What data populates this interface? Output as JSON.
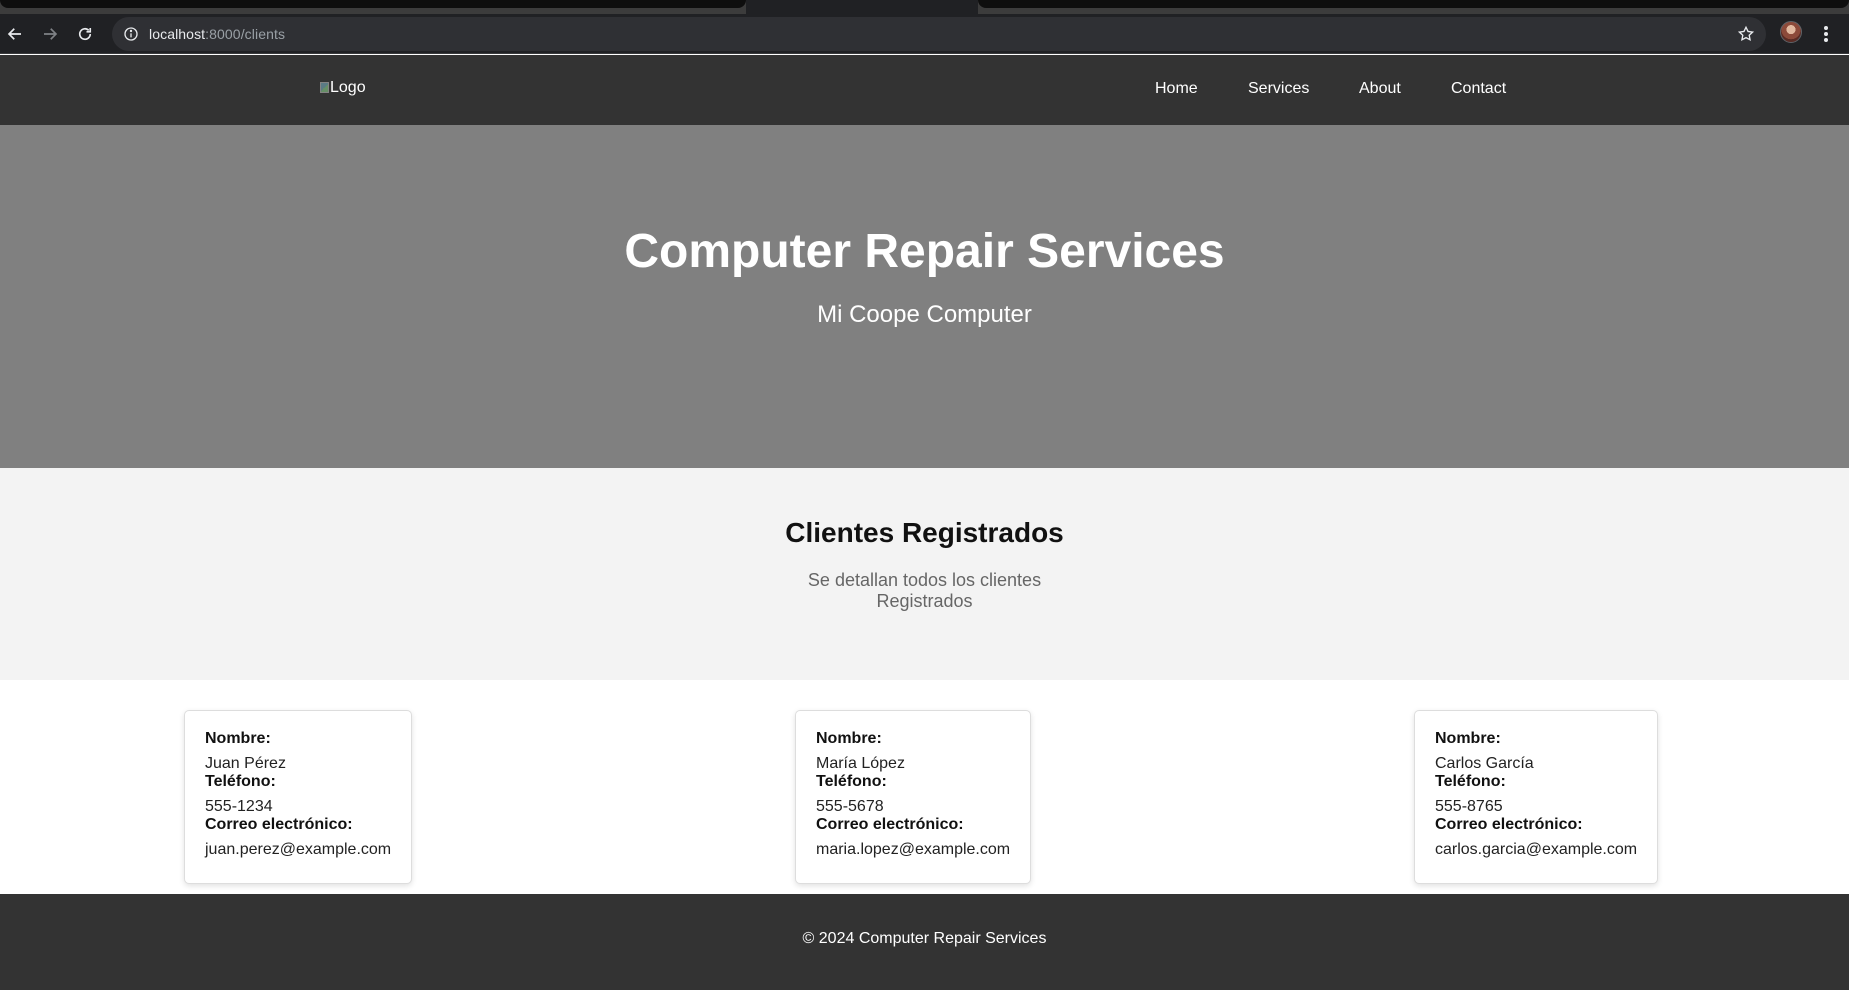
{
  "browser": {
    "url_host": "localhost",
    "url_rest": ":8000/clients",
    "icons": [
      "back-icon",
      "forward-icon",
      "reload-icon",
      "site-info-icon",
      "star-icon",
      "profile-avatar",
      "menu-icon"
    ]
  },
  "nav": {
    "logo_alt": "Logo",
    "links": [
      "Home",
      "Services",
      "About",
      "Contact"
    ]
  },
  "hero": {
    "title": "Computer Repair Services",
    "subtitle": "Mi Coope Computer"
  },
  "intro": {
    "heading": "Clientes Registrados",
    "description": "Se detallan todos los clientes Registrados"
  },
  "labels": {
    "name": "Nombre:",
    "phone": "Teléfono:",
    "email": "Correo electrónico:"
  },
  "clients": [
    {
      "name": "Juan Pérez",
      "phone": "555-1234",
      "email": "juan.perez@example.com"
    },
    {
      "name": "María López",
      "phone": "555-5678",
      "email": "maria.lopez@example.com"
    },
    {
      "name": "Carlos García",
      "phone": "555-8765",
      "email": "carlos.garcia@example.com"
    }
  ],
  "footer": {
    "text": "© 2024 Computer Repair Services"
  },
  "colors": {
    "nav_bg": "#333333",
    "hero_bg": "#808080",
    "intro_bg": "#f3f3f3",
    "footer_bg": "#333333"
  }
}
